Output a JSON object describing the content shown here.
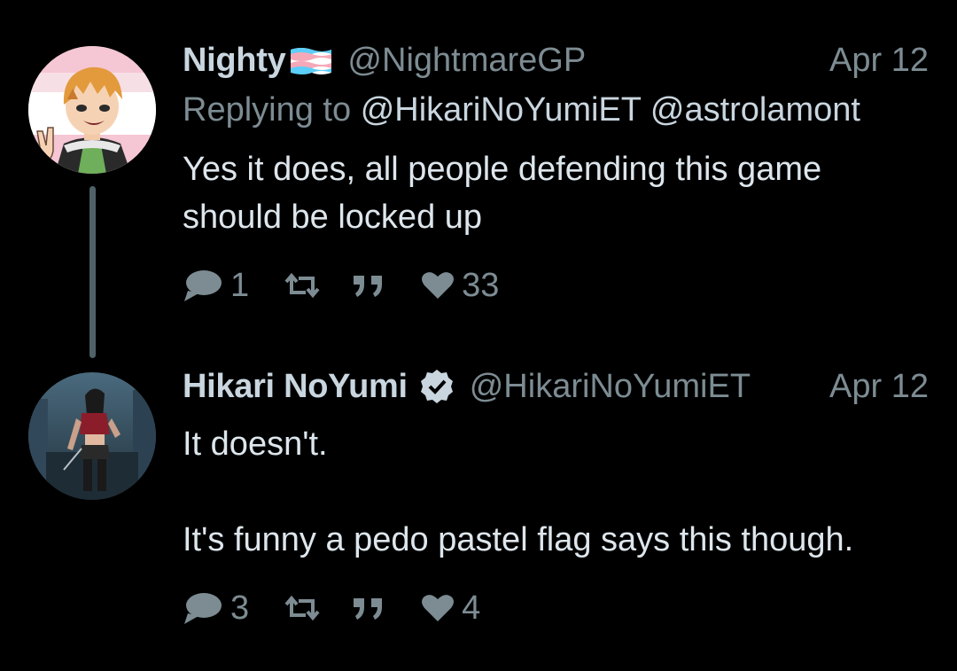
{
  "tweets": [
    {
      "name": "Nighty",
      "handle": "@NightmareGP",
      "date": "Apr 12",
      "replying_prefix": "Replying to",
      "replying_mentions": "@HikariNoYumiET @astrolamont",
      "text": "Yes it does, all people defending this game\nshould be locked up",
      "reply_count": "1",
      "like_count": "33",
      "name_flag_icon": "transgender-flag-icon"
    },
    {
      "name": "Hikari NoYumi",
      "handle": "@HikariNoYumiET",
      "date": "Apr 12",
      "verified": true,
      "text": "It doesn't.\n\nIt's funny a pedo pastel flag says this though.",
      "reply_count": "3",
      "like_count": "4"
    }
  ],
  "colors": {
    "background": "#000000",
    "primary_text": "#dde6ec",
    "secondary_text": "#7d8c93",
    "thread_line": "#4f6268"
  }
}
